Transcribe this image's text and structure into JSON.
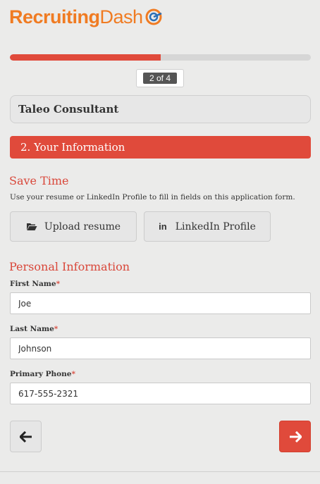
{
  "brand": {
    "name_bold": "Recruiting",
    "name_light": "Dash",
    "orange": "#f07b22",
    "blue": "#2b6fb6"
  },
  "progress": {
    "current_step": 2,
    "total_steps": 4,
    "fraction": 0.5,
    "step_label": "2 of 4",
    "fill_color": "#e04a3b"
  },
  "job": {
    "title": "Taleo Consultant"
  },
  "section": {
    "title": "2. Your Information"
  },
  "save_time": {
    "title": "Save Time",
    "description": "Use your resume or LinkedIn Profile to fill in fields on this application form.",
    "upload_label": "Upload resume",
    "upload_icon": "folder-open-icon",
    "linkedin_label": "LinkedIn Profile",
    "linkedin_icon": "linkedin-icon",
    "linkedin_glyph": "in"
  },
  "personal": {
    "title": "Personal Information",
    "required_mark": "*",
    "fields": {
      "first_name": {
        "label": "First Name",
        "value": "Joe"
      },
      "last_name": {
        "label": "Last Name",
        "value": "Johnson"
      },
      "primary_phone": {
        "label": "Primary Phone",
        "value": "617-555-2321"
      }
    }
  },
  "nav": {
    "back_icon": "arrow-left-icon",
    "next_icon": "arrow-right-icon",
    "accent": "#e04a3b"
  }
}
